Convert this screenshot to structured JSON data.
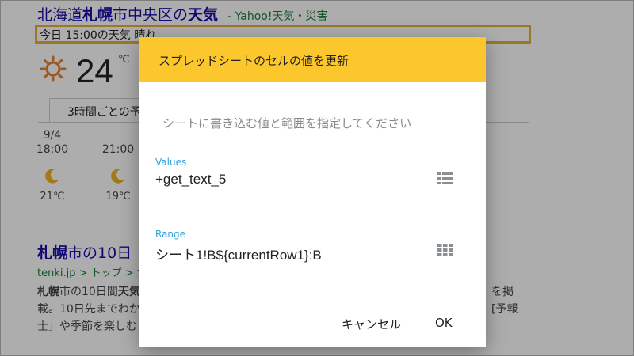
{
  "background": {
    "result_title_part1": "北海道",
    "result_title_bold1": "札幌",
    "result_title_part2": "市中央区の",
    "result_title_bold2": "天気",
    "result_source": "- Yahoo!天気・災害",
    "now_label": "今日 15:00の天気 晴れ",
    "current_temp": "24",
    "temp_unit": "℃",
    "tab_label": "3時間ごとの予",
    "forecast": [
      {
        "date": "9/4",
        "time": "18:00",
        "temp": "21℃"
      },
      {
        "date": "",
        "time": "21:00",
        "temp": "19℃"
      }
    ],
    "result2_title_bold": "札幌",
    "result2_title_rest": "市の10日",
    "result2_url": "tenki.jp > トップ > 北",
    "result2_snip_l1_bold1": "札幌",
    "result2_snip_l1_mid": "市の10日間",
    "result2_snip_l1_bold2": "天気",
    "result2_snip_l1_right": "を掲",
    "result2_snip_l2": "載。10日先までわか",
    "result2_snip_l2_right": "[予報",
    "result2_snip_l3": "士」や季節を楽しむ",
    "colors": {
      "link": "#1a0dab",
      "url": "#1a7f37",
      "highlight": "#e2b13c",
      "sun": "#e8802a",
      "moon": "#f2b21b"
    }
  },
  "dialog": {
    "title": "スプレッドシートのセルの値を更新",
    "description": "シートに書き込む値と範囲を指定してください",
    "fields": [
      {
        "label": "Values",
        "value": "+get_text_5",
        "icon": "list-icon"
      },
      {
        "label": "Range",
        "value": "シート1!B${currentRow1}:B",
        "icon": "grid-icon"
      }
    ],
    "cancel_label": "キャンセル",
    "ok_label": "OK",
    "colors": {
      "header": "#fcc72c",
      "label": "#2f9fd8"
    }
  }
}
